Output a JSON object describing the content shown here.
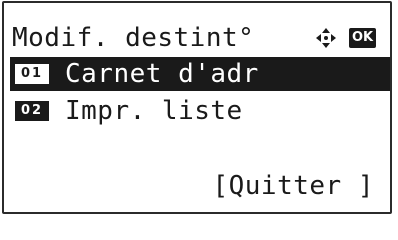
{
  "screen": {
    "title": "Modif. destint°",
    "nav_icon": "four-way-arrow-icon",
    "ok_label": "OK"
  },
  "menu": {
    "items": [
      {
        "number": "01",
        "label": "Carnet d'adr",
        "selected": true
      },
      {
        "number": "02",
        "label": "Impr. liste",
        "selected": false
      }
    ]
  },
  "softkey": {
    "label": "[Quitter ]"
  },
  "colors": {
    "background": "#ffffff",
    "foreground": "#1a1a1a"
  }
}
